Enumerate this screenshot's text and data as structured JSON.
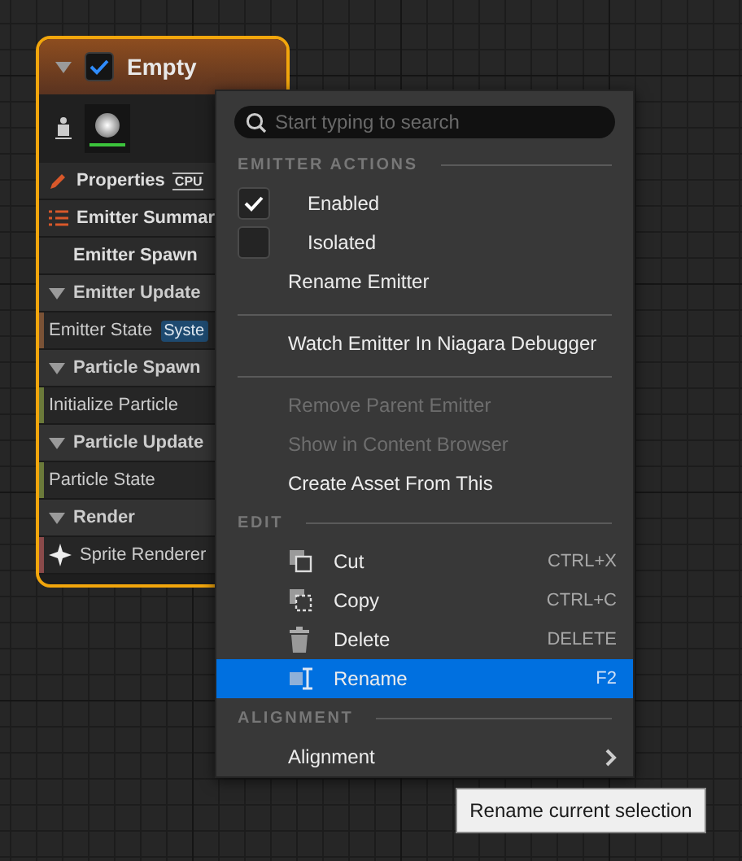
{
  "node": {
    "title": "Empty",
    "enabled": true,
    "rows": [
      {
        "kind": "properties",
        "label": "Properties",
        "badge": "CPU"
      },
      {
        "kind": "summary",
        "label": "Emitter Summar"
      },
      {
        "kind": "stage",
        "label": "Emitter Spawn"
      },
      {
        "kind": "section",
        "label": "Emitter Update"
      },
      {
        "kind": "module",
        "label": "Emitter State",
        "badge": "Syste",
        "color": "#7a5236"
      },
      {
        "kind": "section",
        "label": "Particle Spawn"
      },
      {
        "kind": "module",
        "label": "Initialize Particle",
        "color": "#6b7a3a"
      },
      {
        "kind": "section",
        "label": "Particle Update"
      },
      {
        "kind": "module",
        "label": "Particle State",
        "color": "#6b7a3a"
      },
      {
        "kind": "section",
        "label": "Render"
      },
      {
        "kind": "renderer",
        "label": "Sprite Renderer",
        "color": "#8a4a4a"
      }
    ]
  },
  "menu": {
    "search": {
      "placeholder": "Start typing to search"
    },
    "groups": [
      {
        "header": "EMITTER ACTIONS",
        "items": [
          {
            "kind": "check",
            "label": "Enabled",
            "checked": true
          },
          {
            "kind": "check",
            "label": "Isolated",
            "checked": false
          },
          {
            "kind": "plain",
            "label": "Rename Emitter",
            "disabled": false
          }
        ]
      },
      {
        "items": [
          {
            "kind": "plain",
            "label": "Watch Emitter In Niagara Debugger",
            "disabled": false
          }
        ]
      },
      {
        "items": [
          {
            "kind": "plain",
            "label": "Remove Parent Emitter",
            "disabled": true
          },
          {
            "kind": "plain",
            "label": "Show in Content Browser",
            "disabled": true
          },
          {
            "kind": "plain",
            "label": "Create Asset From This",
            "disabled": false
          }
        ]
      },
      {
        "header": "EDIT",
        "items": [
          {
            "kind": "action",
            "label": "Cut",
            "shortcut": "CTRL+X",
            "selected": false
          },
          {
            "kind": "action",
            "label": "Copy",
            "shortcut": "CTRL+C",
            "selected": false
          },
          {
            "kind": "action",
            "label": "Delete",
            "shortcut": "DELETE",
            "selected": false
          },
          {
            "kind": "action",
            "label": "Rename",
            "shortcut": "F2",
            "selected": true
          }
        ]
      },
      {
        "header": "ALIGNMENT",
        "items": [
          {
            "kind": "submenu",
            "label": "Alignment"
          }
        ]
      }
    ]
  },
  "tooltip": "Rename current selection"
}
